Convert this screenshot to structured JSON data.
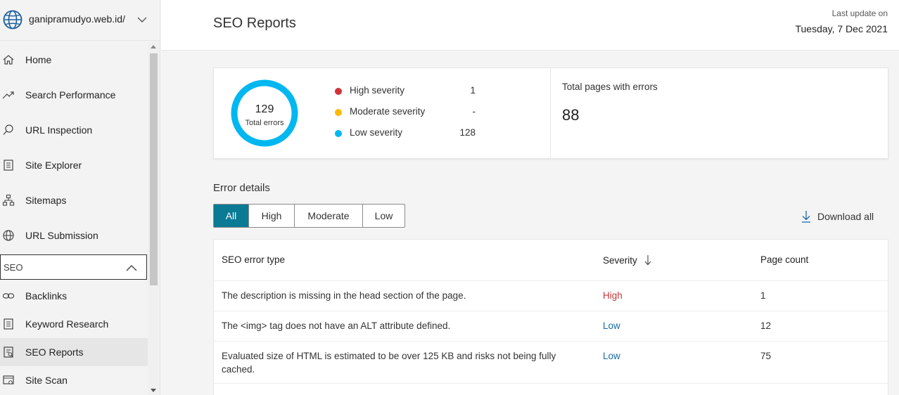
{
  "sidebar": {
    "site_name": "ganipramudyo.web.id/",
    "items": [
      {
        "label": "Home",
        "icon": "home-icon"
      },
      {
        "label": "Search Performance",
        "icon": "trend-icon"
      },
      {
        "label": "URL Inspection",
        "icon": "search-icon"
      },
      {
        "label": "Site Explorer",
        "icon": "document-icon"
      },
      {
        "label": "Sitemaps",
        "icon": "sitemap-icon"
      },
      {
        "label": "URL Submission",
        "icon": "globe-icon"
      }
    ],
    "group_label": "SEO",
    "group_items": [
      {
        "label": "Backlinks",
        "icon": "link-icon"
      },
      {
        "label": "Keyword Research",
        "icon": "document-icon"
      },
      {
        "label": "SEO Reports",
        "icon": "report-icon"
      },
      {
        "label": "Site Scan",
        "icon": "scan-icon"
      }
    ]
  },
  "header": {
    "title": "SEO Reports",
    "last_update_label": "Last update on",
    "last_update_date": "Tuesday, 7 Dec 2021"
  },
  "summary": {
    "total_errors": "129",
    "total_errors_label": "Total errors",
    "severities": [
      {
        "label": "High severity",
        "value": "1",
        "color": "#d13438"
      },
      {
        "label": "Moderate severity",
        "value": "-",
        "color": "#ffb900"
      },
      {
        "label": "Low severity",
        "value": "128",
        "color": "#00b7f0"
      }
    ],
    "total_pages_label": "Total pages with errors",
    "total_pages_value": "88"
  },
  "error_details": {
    "title": "Error details",
    "filters": [
      "All",
      "High",
      "Moderate",
      "Low"
    ],
    "active_filter": "All",
    "download_label": "Download all"
  },
  "table": {
    "headers": {
      "type": "SEO error type",
      "severity": "Severity",
      "count": "Page count"
    },
    "rows": [
      {
        "type_line1": "The description is missing in the head section of the page.",
        "type_line2": "",
        "severity": "High",
        "count": "1"
      },
      {
        "type_line1": "The <img> tag does not have an ALT attribute defined.",
        "type_line2": "",
        "severity": "Low",
        "count": "12"
      },
      {
        "type_line1": "Evaluated size of HTML is estimated to be over 125 KB and risks not being fully",
        "type_line2": "cached.",
        "severity": "Low",
        "count": "75"
      }
    ]
  },
  "colors": {
    "accent": "#0b7a94",
    "high": "#c03a3a",
    "low": "#1a68a8",
    "donut": "#00b7f0"
  }
}
